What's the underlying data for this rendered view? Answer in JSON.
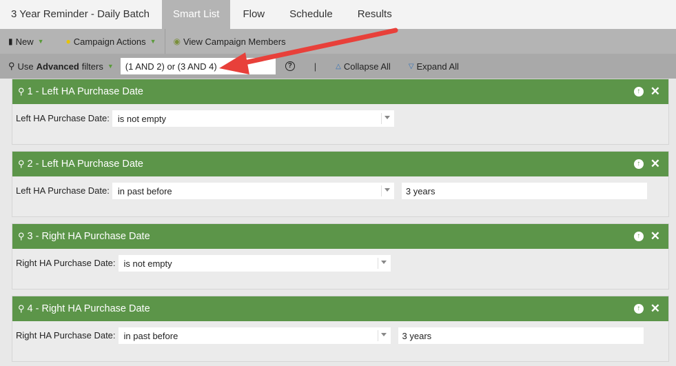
{
  "tabs": [
    {
      "label": "3 Year Reminder - Daily Batch",
      "active": false
    },
    {
      "label": "Smart List",
      "active": true
    },
    {
      "label": "Flow",
      "active": false
    },
    {
      "label": "Schedule",
      "active": false
    },
    {
      "label": "Results",
      "active": false
    }
  ],
  "toolbar": {
    "new_label": "New",
    "campaign_actions_label": "Campaign Actions",
    "view_members_label": "View Campaign Members"
  },
  "filterbar": {
    "use_label": "Use",
    "advanced_label": "Advanced",
    "filters_label": "filters",
    "logic_value": "(1 AND 2) or (3 AND 4)",
    "pipe": "|",
    "collapse_label": "Collapse All",
    "expand_label": "Expand All"
  },
  "filters": [
    {
      "title": "1 - Left HA Purchase Date",
      "label": "Left HA Purchase Date:",
      "operator": "is not empty",
      "value": null
    },
    {
      "title": "2 - Left HA Purchase Date",
      "label": "Left HA Purchase Date:",
      "operator": "in past before",
      "value": "3 years"
    },
    {
      "title": "3 - Right HA Purchase Date",
      "label": "Right HA Purchase Date:",
      "operator": "is not empty",
      "value": null
    },
    {
      "title": "4 - Right HA Purchase Date",
      "label": "Right HA Purchase Date:",
      "operator": "in past before",
      "value": "3 years"
    }
  ],
  "colors": {
    "header_green": "#5c9549",
    "annotation_red": "#e8403a",
    "link_blue": "#2e6fb8"
  }
}
